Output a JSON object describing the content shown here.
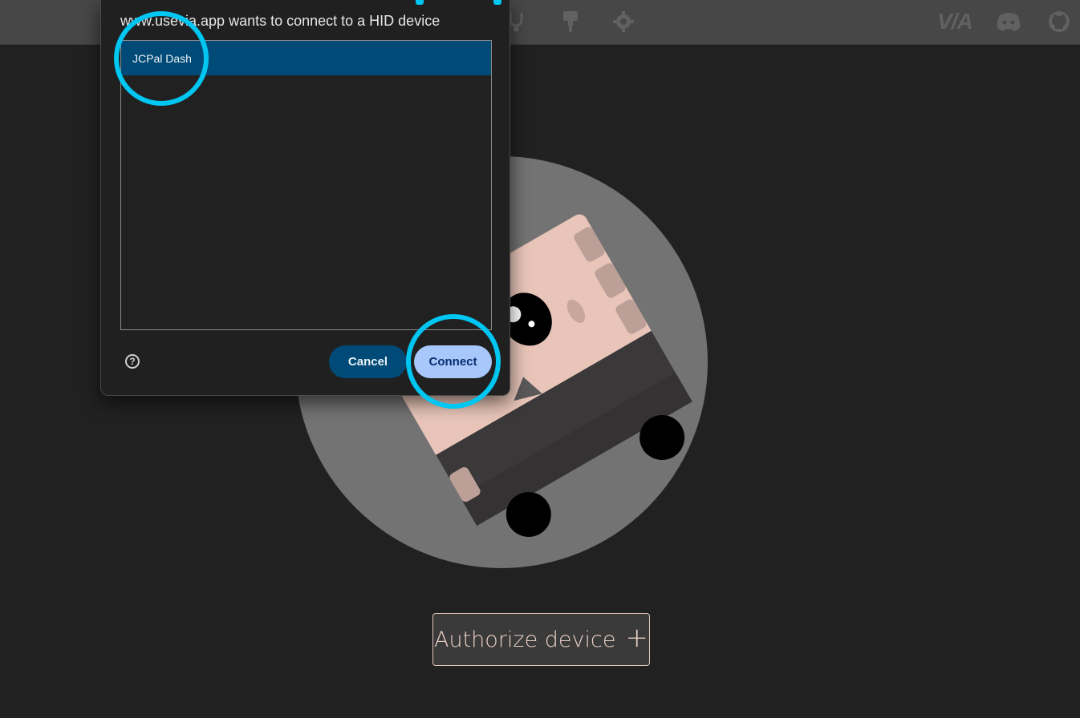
{
  "topbar": {
    "icons": [
      "stethoscope-icon",
      "paintbrush-icon",
      "gear-icon",
      "discord-icon",
      "github-icon"
    ],
    "logo_text": "V/A"
  },
  "dialog": {
    "title": "www.usevia.app wants to connect to a HID device",
    "devices": [
      {
        "label": "JCPal Dash",
        "selected": true
      }
    ],
    "cancel_label": "Cancel",
    "connect_label": "Connect",
    "help_icon": "help-icon"
  },
  "main": {
    "authorize_label": "Authorize device",
    "authorize_icon": "plus-icon"
  },
  "colors": {
    "background": "#212121",
    "topbar": "#474747",
    "selection": "#004a77",
    "connect": "#a8c7fa",
    "highlight_ring": "#00c6f2",
    "authorize_text": "#e8cfc4"
  }
}
